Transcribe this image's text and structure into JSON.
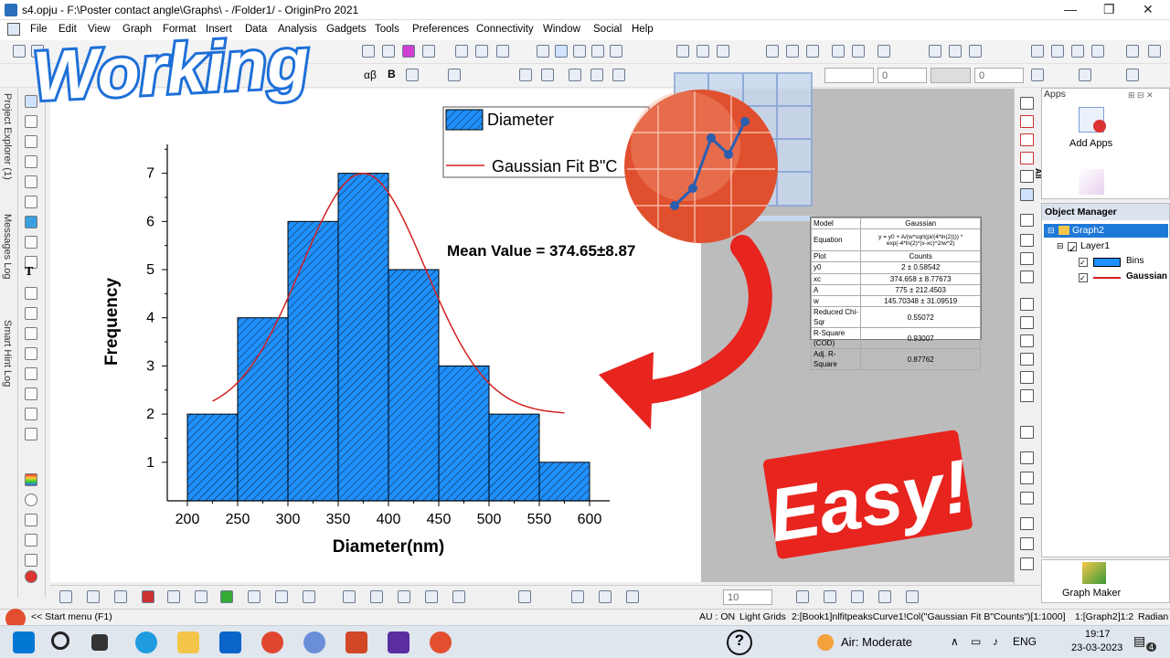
{
  "window": {
    "title": "s4.opju - F:\\Poster contact angle\\Graphs\\ - /Folder1/ - OriginPro 2021",
    "minimize": "—",
    "maximize": "❐",
    "close": "✕"
  },
  "menu": [
    "File",
    "Edit",
    "View",
    "Graph",
    "Format",
    "Insert",
    "Data",
    "Analysis",
    "Gadgets",
    "Tools",
    "Preferences",
    "Connectivity",
    "Window",
    "Social",
    "Help"
  ],
  "left_dock": {
    "project_explorer": "Project Explorer (1)",
    "messages_log": "Messages Log",
    "smart_hint_log": "Smart Hint Log"
  },
  "toolbar_text": {
    "font_style": "αβ",
    "bold": "B",
    "zoom_value": "10",
    "line_width": "0"
  },
  "legend": {
    "entries": [
      {
        "label": "Diameter"
      },
      {
        "label": "Gaussian Fit B\"C"
      }
    ]
  },
  "annotation": "Mean Value = 374.65±8.87",
  "chart_data": {
    "type": "bar",
    "xlabel": "Diameter(nm)",
    "ylabel": "Frequency",
    "bins": [
      [
        200,
        250
      ],
      [
        250,
        300
      ],
      [
        300,
        350
      ],
      [
        350,
        400
      ],
      [
        400,
        450
      ],
      [
        450,
        500
      ],
      [
        500,
        550
      ],
      [
        550,
        600
      ]
    ],
    "values": [
      2,
      4,
      6,
      7,
      5,
      3,
      2,
      1
    ],
    "xticks": [
      200,
      250,
      300,
      350,
      400,
      450,
      500,
      550,
      600
    ],
    "yticks": [
      1,
      2,
      3,
      4,
      5,
      6,
      7
    ],
    "xlim": [
      180,
      620
    ],
    "ylim": [
      0.2,
      7.6
    ],
    "bar_color": "#1e90ff",
    "fit_color": "#d42020",
    "fit": {
      "y0": 2,
      "xc": 374.658,
      "A": 775,
      "w": 145.70348,
      "xrange": [
        225,
        575
      ]
    }
  },
  "fit_table": [
    [
      "Model",
      "Gaussian"
    ],
    [
      "Equation",
      "y = y0 + A/(w*sqrt(pi/(4*ln(2)))) * exp(-4*ln(2)*(x-xc)^2/w^2)"
    ],
    [
      "Plot",
      "Counts"
    ],
    [
      "y0",
      "2 ± 0.58542"
    ],
    [
      "xc",
      "374.658 ± 8.77673"
    ],
    [
      "A",
      "775 ± 212.4503"
    ],
    [
      "w",
      "145.70348 ± 31.09519"
    ],
    [
      "Reduced Chi-Sqr",
      "0.55072"
    ],
    [
      "R-Square (COD)",
      "0.93007"
    ],
    [
      "Adj. R-Square",
      "0.87762"
    ]
  ],
  "apps_panel": {
    "title": "Apps",
    "add_apps": "Add Apps"
  },
  "object_manager": {
    "title": "Object Manager",
    "graph": "Graph2",
    "layer": "Layer1",
    "items": [
      "Bins",
      "Gaussian"
    ]
  },
  "graph_maker": "Graph Maker",
  "right_tab": "All",
  "status": {
    "start": "<< Start menu (F1)",
    "au": "AU : ON",
    "grids": "Light Grids",
    "info": "2:[Book1]nlfitpeaksCurve1!Col(\"Gaussian Fit B\"Counts\")[1:1000]",
    "graph": "1:[Graph2]1:2",
    "angle": "Radian"
  },
  "taskbar": {
    "air": "Air: Moderate",
    "lang": "ENG",
    "time": "19:17",
    "date": "23-03-2023",
    "notif": "4"
  },
  "overlay": {
    "working": "Working",
    "easy": "Easy!"
  },
  "colors": {
    "accent": "#1e90ff",
    "fit": "#d42020",
    "arrow": "#e8241e"
  }
}
